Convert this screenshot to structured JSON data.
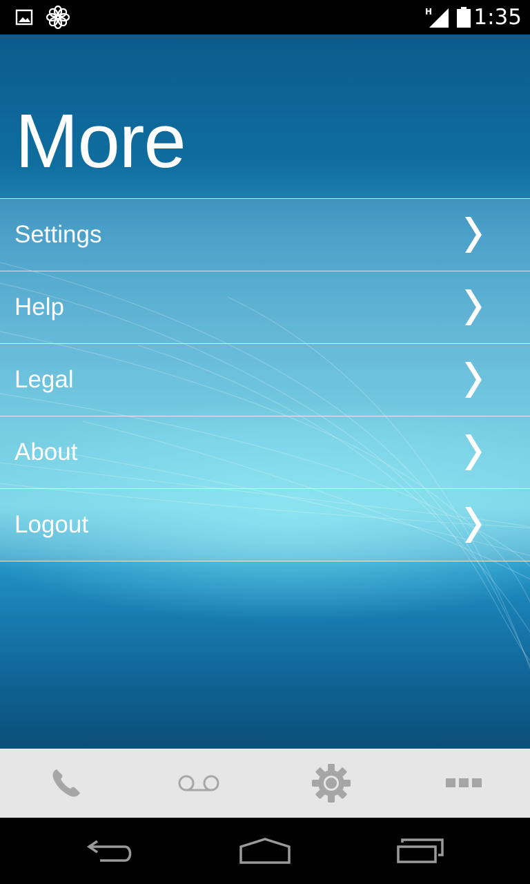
{
  "status_bar": {
    "time": "1:35",
    "network_type": "H",
    "icons": [
      "picture-icon",
      "flower-icon",
      "signal-icon",
      "battery-icon"
    ]
  },
  "page": {
    "title": "More"
  },
  "menu": {
    "items": [
      {
        "label": "Settings",
        "icon": "chevron-right-icon"
      },
      {
        "label": "Help",
        "icon": "chevron-right-icon"
      },
      {
        "label": "Legal",
        "icon": "chevron-right-icon"
      },
      {
        "label": "About",
        "icon": "chevron-right-icon"
      },
      {
        "label": "Logout",
        "icon": "chevron-right-icon"
      }
    ]
  },
  "tab_bar": {
    "tabs": [
      {
        "icon": "phone-icon"
      },
      {
        "icon": "voicemail-icon"
      },
      {
        "icon": "gear-icon"
      },
      {
        "icon": "more-icon"
      }
    ]
  },
  "nav_bar": {
    "buttons": [
      "back-icon",
      "home-icon",
      "recent-apps-icon"
    ]
  },
  "colors": {
    "accent": "#1677ac",
    "tab_bar_background": "#e6e6e6",
    "tab_icon": "#a6a6a6",
    "text": "#ffffff"
  }
}
